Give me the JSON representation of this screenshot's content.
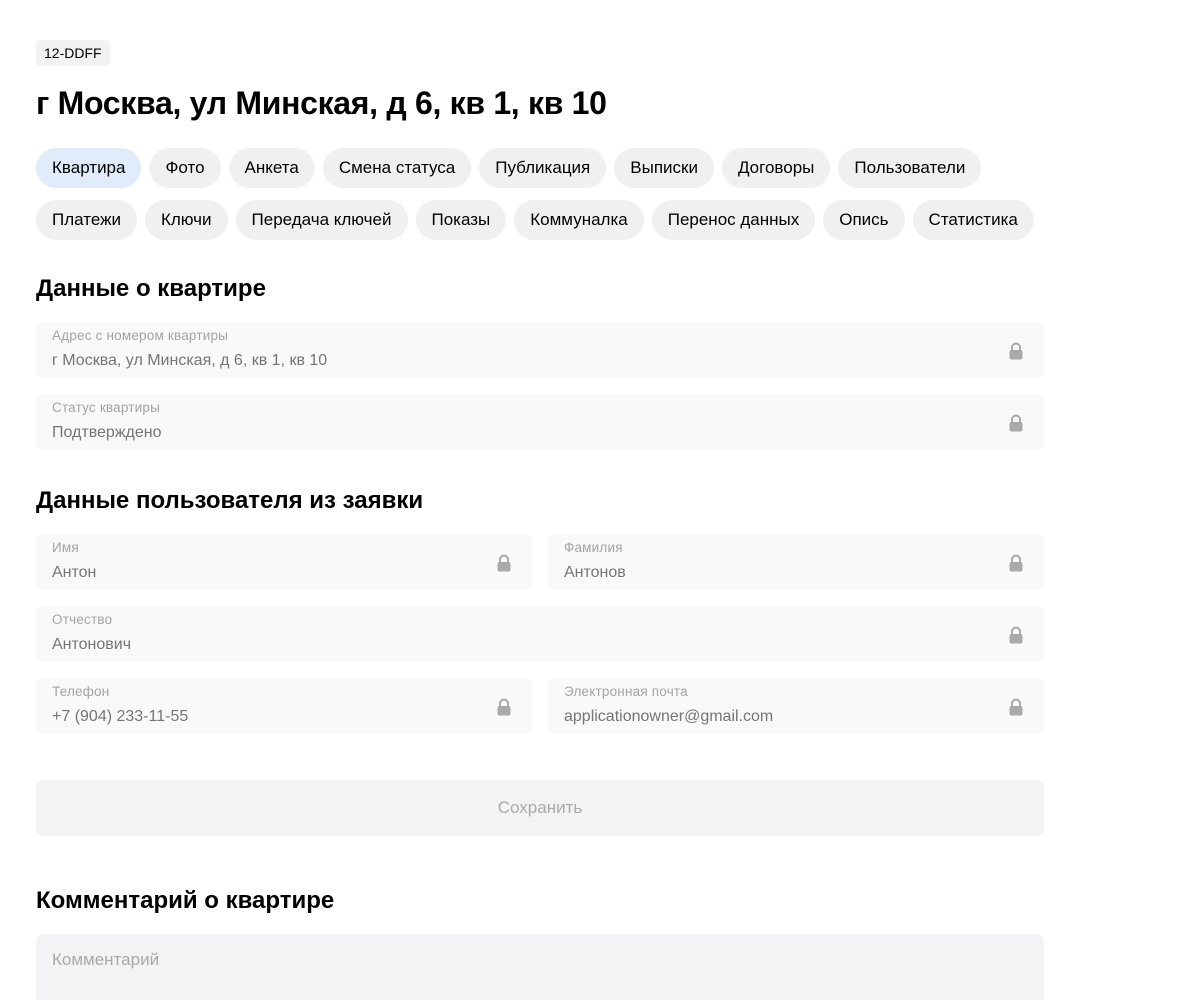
{
  "header": {
    "code": "12-DDFF",
    "title": "г Москва, ул Минская, д 6, кв 1, кв 10"
  },
  "tabs": [
    {
      "label": "Квартира",
      "active": true
    },
    {
      "label": "Фото"
    },
    {
      "label": "Анкета"
    },
    {
      "label": "Смена статуса"
    },
    {
      "label": "Публикация"
    },
    {
      "label": "Выписки"
    },
    {
      "label": "Договоры"
    },
    {
      "label": "Пользователи"
    },
    {
      "label": "Платежи"
    },
    {
      "label": "Ключи"
    },
    {
      "label": "Передача ключей"
    },
    {
      "label": "Показы"
    },
    {
      "label": "Коммуналка"
    },
    {
      "label": "Перенос данных"
    },
    {
      "label": "Опись"
    },
    {
      "label": "Статистика"
    }
  ],
  "flat_section": {
    "title": "Данные о квартире",
    "address": {
      "label": "Адрес с номером квартиры",
      "value": "г Москва, ул Минская, д 6, кв 1, кв 10"
    },
    "status": {
      "label": "Статус квартиры",
      "value": "Подтверждено"
    }
  },
  "user_section": {
    "title": "Данные пользователя из заявки",
    "first_name": {
      "label": "Имя",
      "value": "Антон"
    },
    "last_name": {
      "label": "Фамилия",
      "value": "Антонов"
    },
    "patronymic": {
      "label": "Отчество",
      "value": "Антонович"
    },
    "phone": {
      "label": "Телефон",
      "value": "+7 (904) 233-11-55"
    },
    "email": {
      "label": "Электронная почта",
      "value": "applicationowner@gmail.com"
    }
  },
  "save_label": "Сохранить",
  "comment_section": {
    "title": "Комментарий о квартире",
    "placeholder": "Комментарий"
  },
  "icons": {
    "field_lock": "lock-icon"
  },
  "colors": {
    "active_tab": "#e0ecfa",
    "tab": "#f0f0f0",
    "field_bg": "#f9f9f9"
  }
}
